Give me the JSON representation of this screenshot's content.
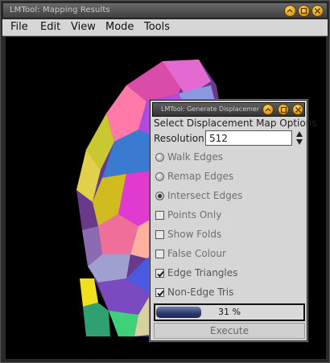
{
  "window": {
    "title": "LMTool: Mapping Results",
    "menu": [
      "File",
      "Edit",
      "View",
      "Mode",
      "Tools"
    ]
  },
  "dialog": {
    "title": "LMTool: Generate Displacement m",
    "heading": "Select Displacement Map Options",
    "resolution_label": "Resolution:",
    "resolution_value": "512",
    "radios": [
      {
        "label": "Walk Edges",
        "selected": false
      },
      {
        "label": "Remap Edges",
        "selected": false
      },
      {
        "label": "Intersect Edges",
        "selected": true
      }
    ],
    "checkboxes": [
      {
        "label": "Points Only",
        "checked": false
      },
      {
        "label": "Show Folds",
        "checked": false
      },
      {
        "label": "False Colour",
        "checked": false
      },
      {
        "label": "Edge Triangles",
        "checked": true
      },
      {
        "label": "Non-Edge Tris",
        "checked": true
      }
    ],
    "progress": {
      "value": 0.31,
      "text": "31 %"
    },
    "execute_label": "Execute"
  },
  "colors": {
    "button_accent": "#e09a12",
    "progress_fill": "#2c3a6a",
    "dialog_bg": "#d6d6d6"
  }
}
